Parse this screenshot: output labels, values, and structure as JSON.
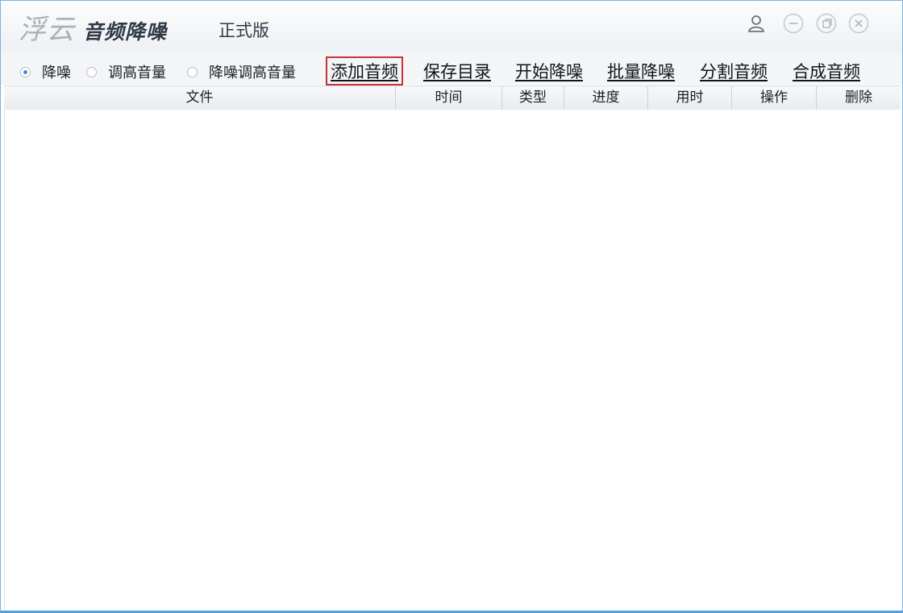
{
  "title": {
    "logo_text": "浮云",
    "app_name": "音频降噪",
    "edition": "正式版"
  },
  "window_controls": [
    "user-icon",
    "minimize-icon",
    "restore-icon",
    "close-icon"
  ],
  "modes": [
    {
      "label": "降噪",
      "checked": true
    },
    {
      "label": "调高音量",
      "checked": false
    },
    {
      "label": "降噪调高音量",
      "checked": false
    }
  ],
  "actions": [
    {
      "label": "添加音频",
      "selected": true
    },
    {
      "label": "保存目录",
      "selected": false
    },
    {
      "label": "开始降噪",
      "selected": false
    },
    {
      "label": "批量降噪",
      "selected": false
    },
    {
      "label": "分割音频",
      "selected": false
    },
    {
      "label": "合成音频",
      "selected": false
    }
  ],
  "columns": [
    "文件",
    "时间",
    "类型",
    "进度",
    "用时",
    "操作",
    "删除"
  ],
  "rows": [],
  "colors": {
    "accent": "#3b8ed8",
    "selection_border": "#c8333c",
    "window_border": "#4fa3e0"
  }
}
